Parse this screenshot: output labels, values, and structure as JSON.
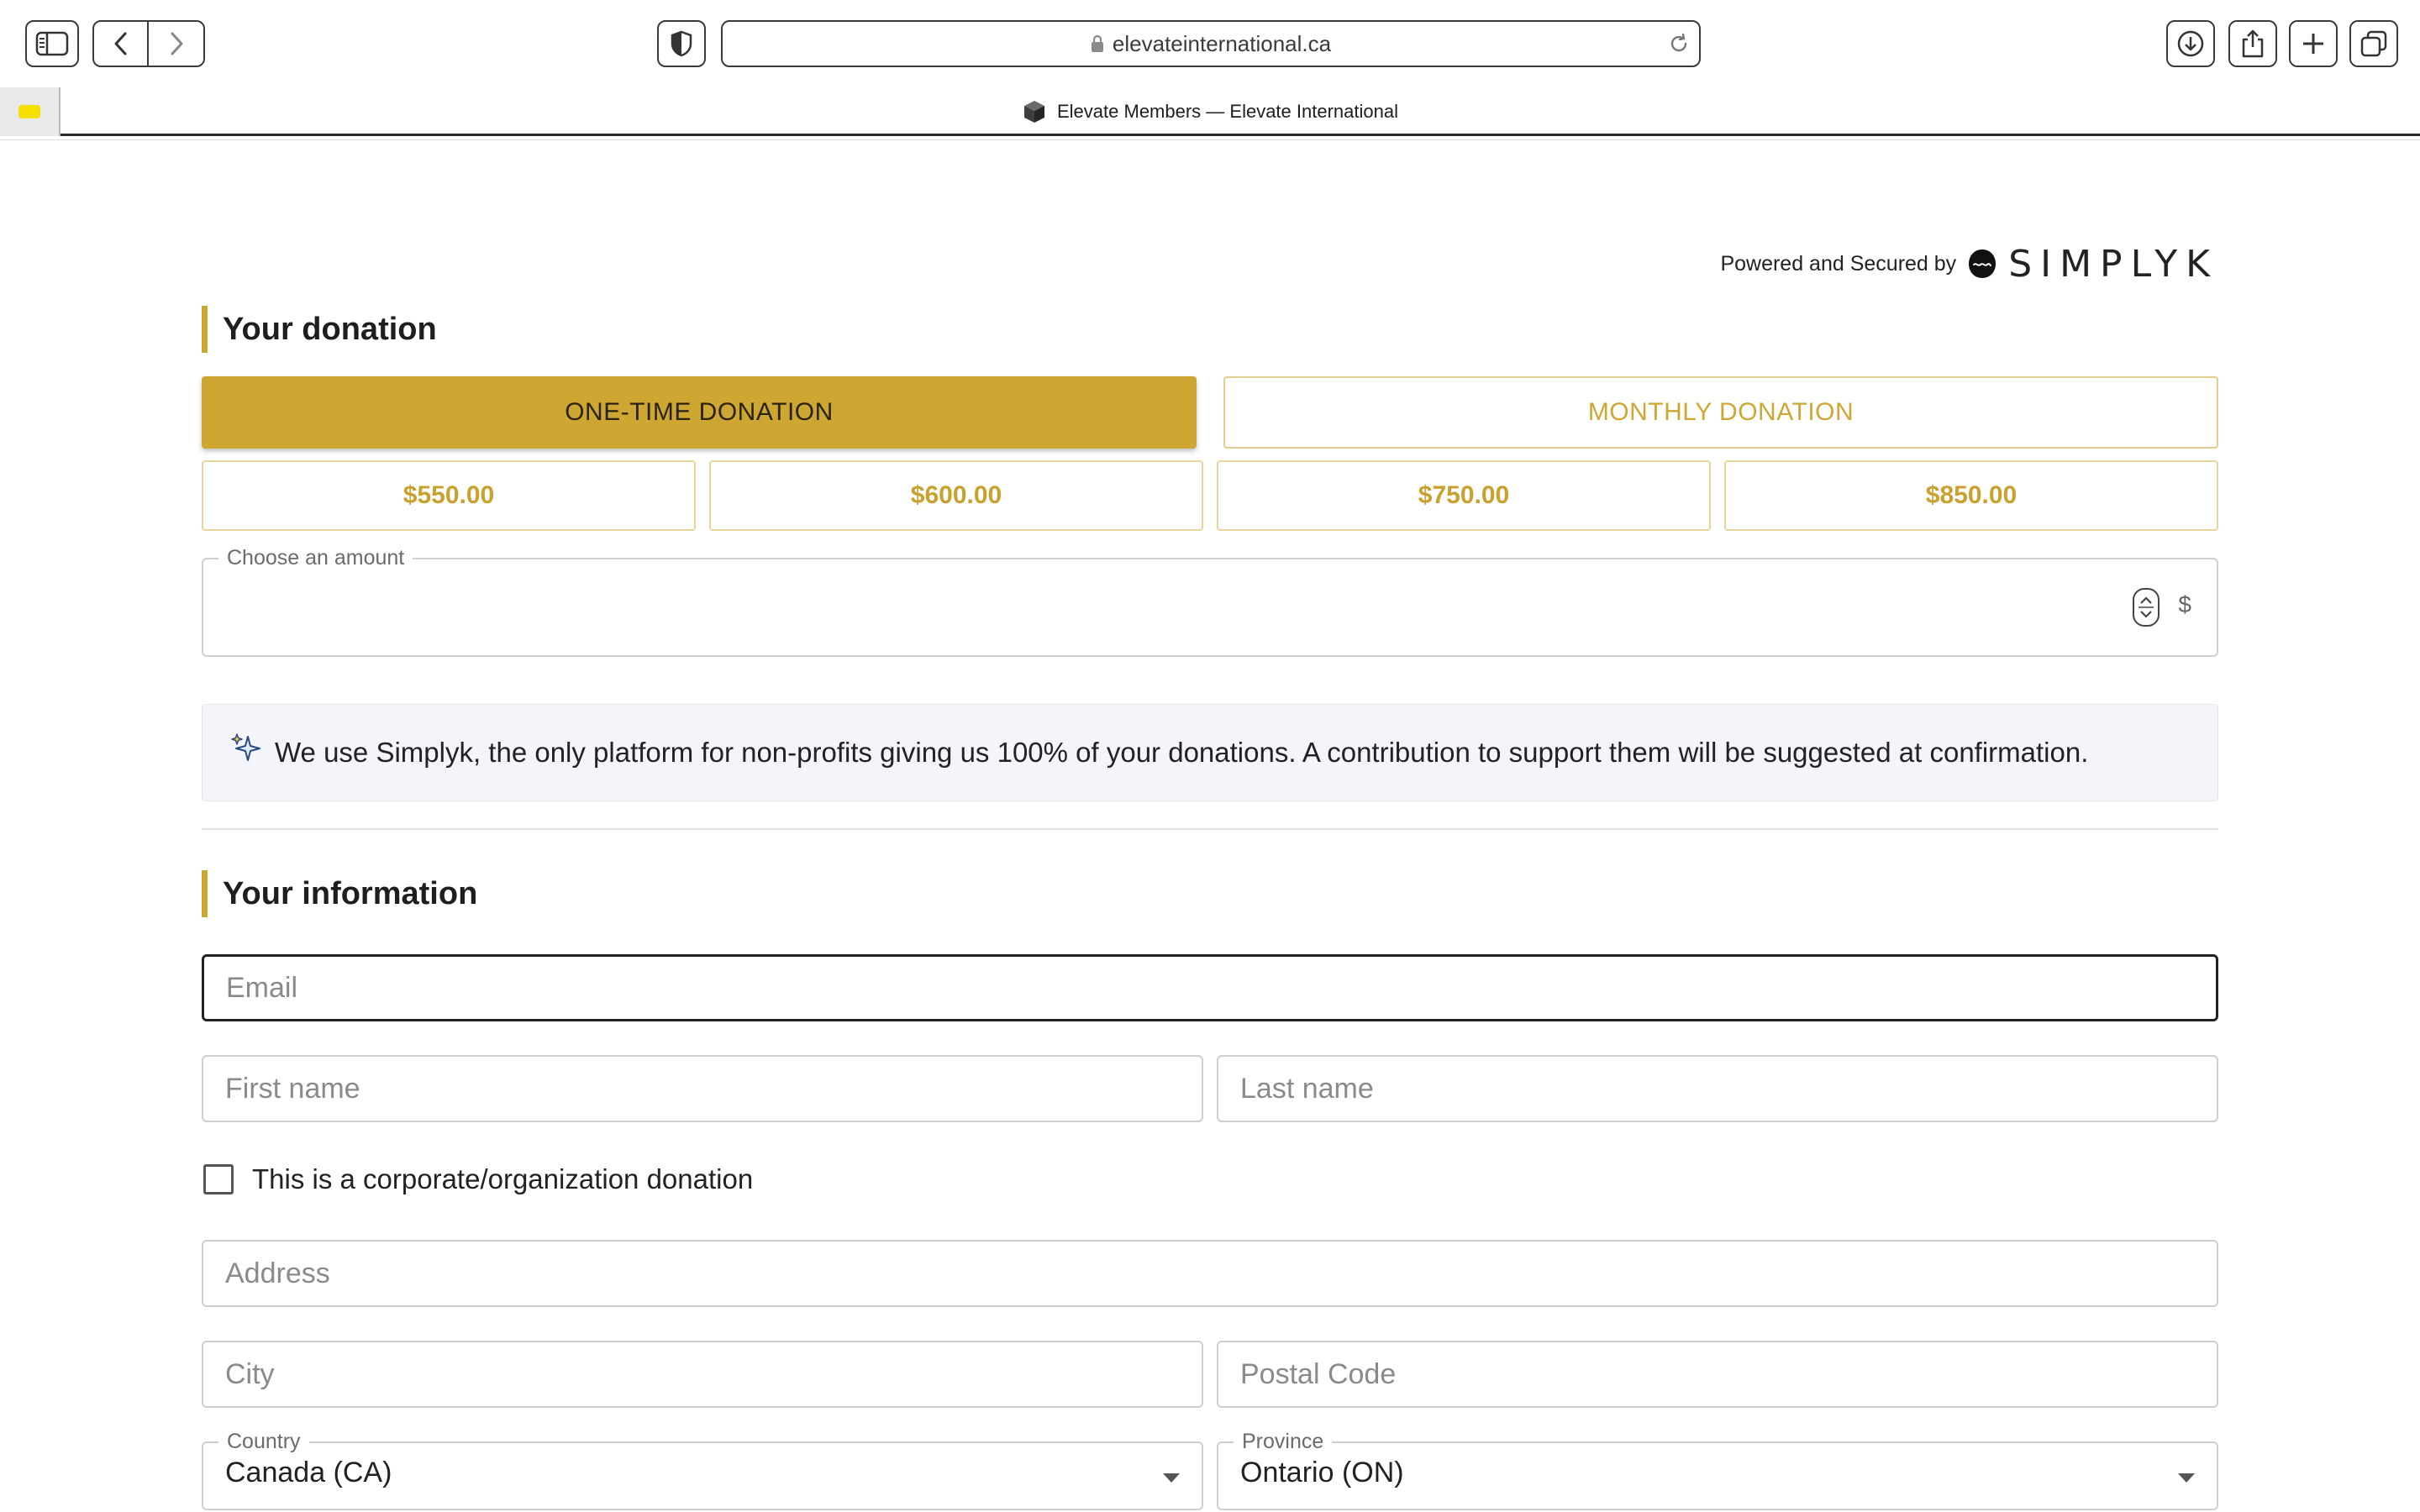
{
  "browser": {
    "url": "elevateinternational.ca",
    "tab_title": "Elevate Members — Elevate International"
  },
  "header": {
    "powered_by": "Powered and Secured by",
    "brand": "SIMPLYK"
  },
  "donation": {
    "title": "Your donation",
    "one_time_label": "ONE-TIME DONATION",
    "monthly_label": "MONTHLY DONATION",
    "amounts": [
      "$550.00",
      "$600.00",
      "$750.00",
      "$850.00"
    ],
    "amount_field_label": "Choose an amount",
    "amount_value": "",
    "currency_symbol": "$",
    "info_text": "We use Simplyk, the only platform for non-profits giving us 100% of your donations. A contribution to support them will be suggested at confirmation."
  },
  "information": {
    "title": "Your information",
    "email_placeholder": "Email",
    "first_name_placeholder": "First name",
    "last_name_placeholder": "Last name",
    "corporate_label": "This is a corporate/organization donation",
    "address_placeholder": "Address",
    "city_placeholder": "City",
    "postal_placeholder": "Postal Code",
    "country_label": "Country",
    "country_value": "Canada (CA)",
    "province_label": "Province",
    "province_value": "Ontario (ON)"
  },
  "colors": {
    "accent": "#cea733",
    "accent_light": "#e6d59c",
    "info_background": "#f3f5fb"
  },
  "icons": {
    "sidebar": "sidebar-icon",
    "back": "chevron-left-icon",
    "forward": "chevron-right-icon",
    "privacy": "shield-icon",
    "lock": "lock-icon",
    "reload": "reload-icon",
    "download": "download-icon",
    "share": "share-icon",
    "new_tab": "plus-icon",
    "tabs": "tabs-overview-icon",
    "info": "sparkle-icon"
  }
}
